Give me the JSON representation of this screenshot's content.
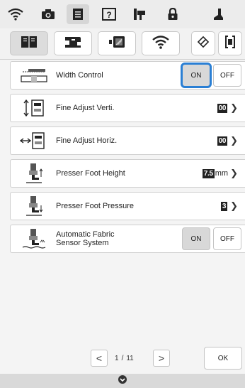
{
  "topbar": {
    "icons": [
      "wifi-icon",
      "camera-icon",
      "document-icon",
      "help-icon",
      "thread-icon",
      "lock-icon",
      "presser-icon"
    ]
  },
  "tabs": {
    "icons": [
      "book-icon",
      "sewing-machine-icon",
      "screen-icon",
      "wifi-icon",
      "eraser-icon",
      "bracket-icon"
    ]
  },
  "rows": {
    "width_control": {
      "label": "Width Control",
      "on": "ON",
      "off": "OFF"
    },
    "fine_vert": {
      "label": "Fine Adjust Verti.",
      "value": "00"
    },
    "fine_horiz": {
      "label": "Fine Adjust Horiz.",
      "value": "00"
    },
    "foot_height": {
      "label": "Presser Foot Height",
      "value": "7.5",
      "unit": "mm"
    },
    "foot_pressure": {
      "label": "Presser Foot Pressure",
      "value": "3"
    },
    "fabric_sensor": {
      "label_line1": "Automatic Fabric",
      "label_line2": "Sensor System",
      "on": "ON",
      "off": "OFF"
    }
  },
  "pager": {
    "prev": "<",
    "next": ">",
    "current": "1",
    "sep": "/",
    "total": "11"
  },
  "ok_label": "OK",
  "accent": "#2a7fd4"
}
